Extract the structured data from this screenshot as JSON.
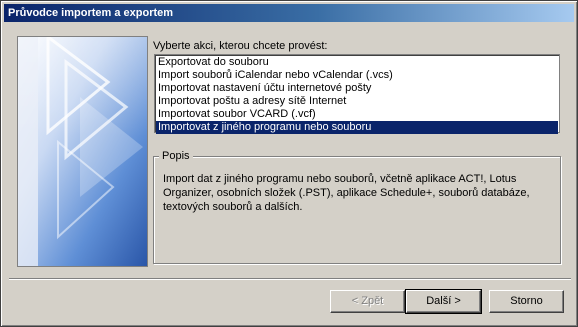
{
  "window": {
    "title": "Průvodce importem a exportem"
  },
  "prompt": "Vyberte akci, kterou chcete provést:",
  "actions": [
    "Exportovat do souboru",
    "Import souborů iCalendar nebo vCalendar (.vcs)",
    "Importovat nastavení účtu internetové pošty",
    "Importovat poštu a adresy sítě Internet",
    "Importovat soubor VCARD (.vcf)",
    "Importovat z jiného programu nebo souboru"
  ],
  "selected_action": "Importovat z jiného programu nebo souboru",
  "description": {
    "title": "Popis",
    "text": "Import dat z jiného programu nebo souborů, včetně aplikace ACT!, Lotus Organizer, osobních složek (.PST), aplikace Schedule+, souborů databáze, textových souborů a dalších."
  },
  "buttons": {
    "back": "< Zpět",
    "next": "Další >",
    "cancel": "Storno"
  },
  "colors": {
    "titlebar": "#0a246a",
    "selection": "#0a246a",
    "dialog_bg": "#d4d0c8",
    "banner_blue": "#4a78c8"
  }
}
